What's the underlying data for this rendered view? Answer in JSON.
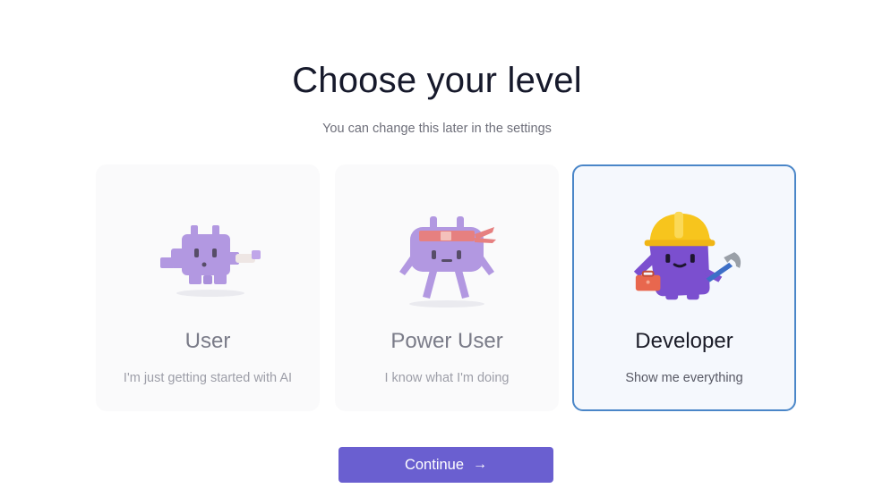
{
  "header": {
    "title": "Choose your level",
    "subtitle": "You can change this later in the settings"
  },
  "levels": [
    {
      "label": "User",
      "description": "I'm just getting started with AI",
      "selected": false,
      "mascot": "user-mascot"
    },
    {
      "label": "Power User",
      "description": "I know what I'm doing",
      "selected": false,
      "mascot": "power-user-mascot"
    },
    {
      "label": "Developer",
      "description": "Show me everything",
      "selected": true,
      "mascot": "developer-mascot"
    }
  ],
  "footer": {
    "continue_label": "Continue",
    "continue_icon": "arrow-right-icon"
  },
  "colors": {
    "accent": "#6a5fd0",
    "selected_border": "#4a86c8",
    "mascot_purple": "#a889df"
  }
}
